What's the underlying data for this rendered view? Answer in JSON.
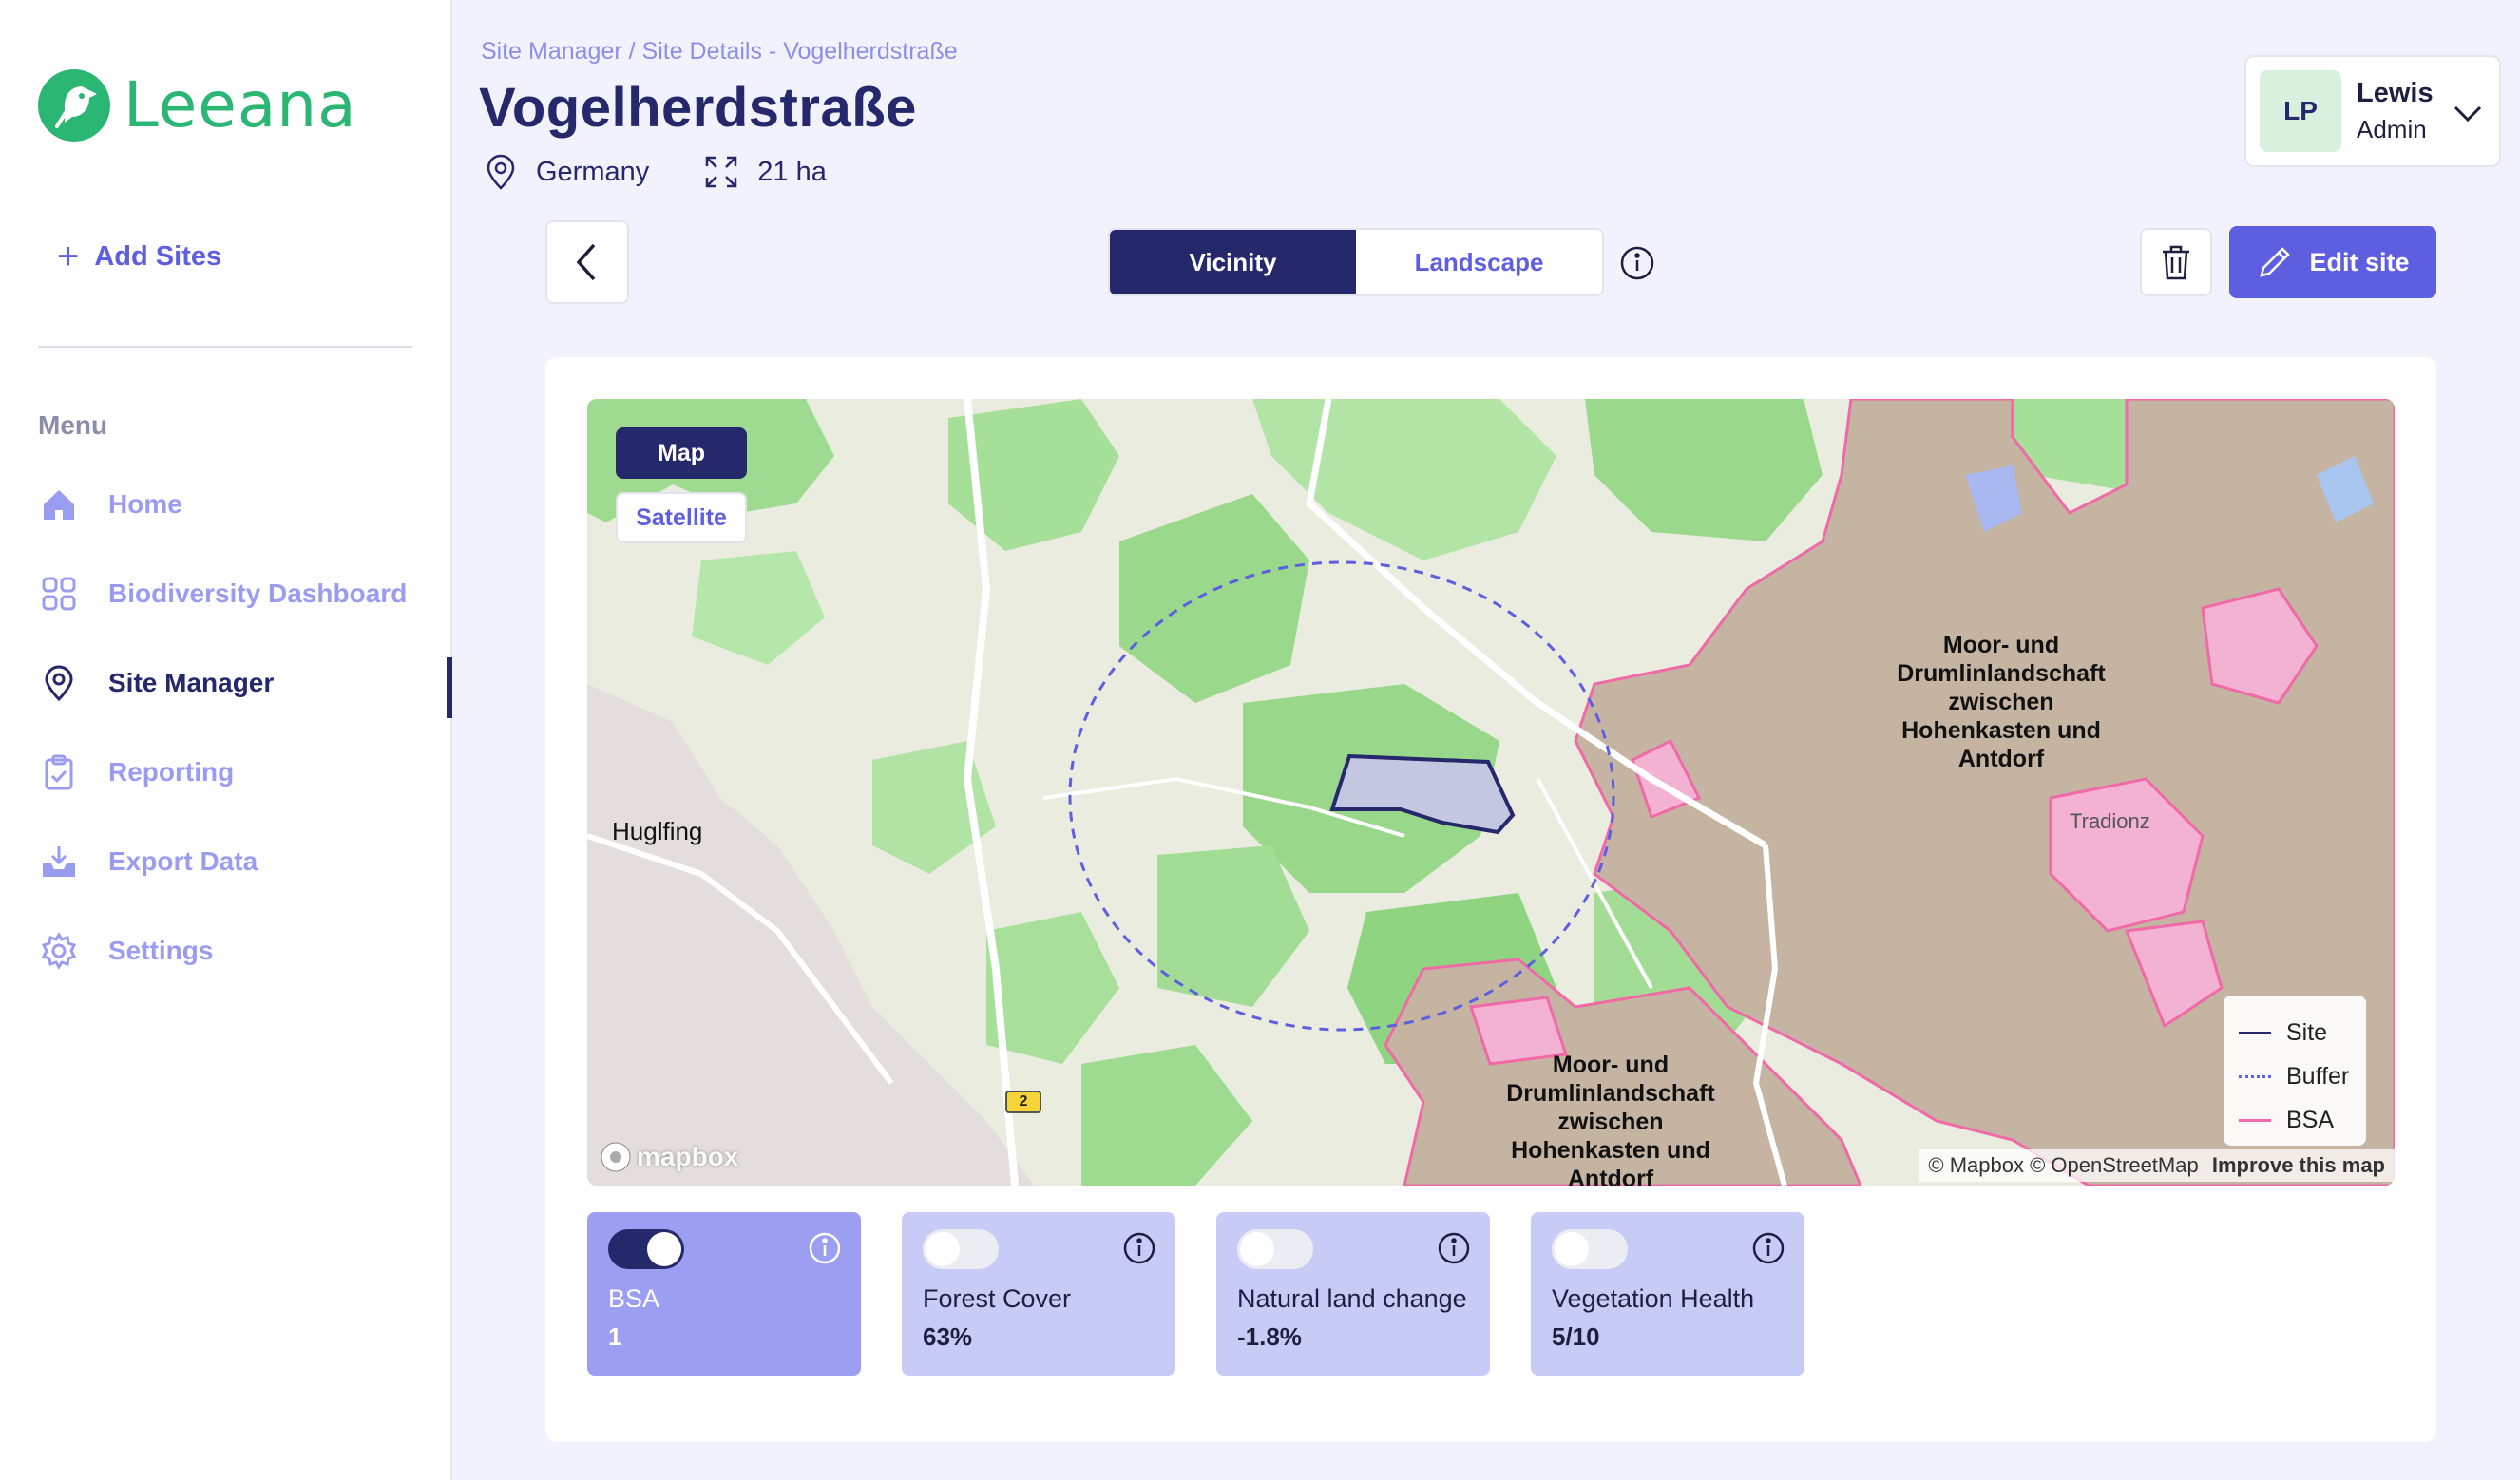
{
  "brand": {
    "name": "Leeana",
    "color": "#2bb673"
  },
  "sidebar": {
    "add_sites": "Add Sites",
    "menu_title": "Menu",
    "items": [
      {
        "label": "Home",
        "icon": "home-icon",
        "active": false
      },
      {
        "label": "Biodiversity Dashboard",
        "icon": "grid-icon",
        "active": false
      },
      {
        "label": "Site Manager",
        "icon": "location-pin-icon",
        "active": true
      },
      {
        "label": "Reporting",
        "icon": "clipboard-icon",
        "active": false
      },
      {
        "label": "Export Data",
        "icon": "download-tray-icon",
        "active": false
      },
      {
        "label": "Settings",
        "icon": "gear-icon",
        "active": false
      }
    ]
  },
  "header": {
    "breadcrumb": "Site Manager / Site Details - Vogelherdstraße",
    "title": "Vogelherdstraße",
    "country": "Germany",
    "area": "21 ha"
  },
  "user": {
    "initials": "LP",
    "name": "Lewis",
    "role": "Admin"
  },
  "toolbar": {
    "tabs": [
      {
        "label": "Vicinity",
        "active": true
      },
      {
        "label": "Landscape",
        "active": false
      }
    ],
    "edit_label": "Edit site"
  },
  "map": {
    "view_options": [
      {
        "label": "Map",
        "active": true
      },
      {
        "label": "Satellite",
        "active": false
      }
    ],
    "places": {
      "town": "Huglfing",
      "bsa_north": "Moor- und Drumlinlandschaft zwischen Hohenkasten und Antdorf",
      "bsa_south": "Moor- und Drumlinlandschaft zwischen Hohenkasten und Antdorf",
      "village": "Tradionz",
      "highway": "2"
    },
    "legend": [
      {
        "label": "Site",
        "color": "#25286b",
        "style": "solid"
      },
      {
        "label": "Buffer",
        "color": "#5d5fe0",
        "style": "dotted"
      },
      {
        "label": "BSA",
        "color": "#f06aa8",
        "style": "solid"
      }
    ],
    "logo": "mapbox",
    "attribution": "© Mapbox © OpenStreetMap",
    "improve": "Improve this map"
  },
  "layers": [
    {
      "name": "BSA",
      "value": "1",
      "enabled": true
    },
    {
      "name": "Forest Cover",
      "value": "63%",
      "enabled": false
    },
    {
      "name": "Natural land change",
      "value": "-1.8%",
      "enabled": false
    },
    {
      "name": "Vegetation Health",
      "value": "5/10",
      "enabled": false
    }
  ]
}
